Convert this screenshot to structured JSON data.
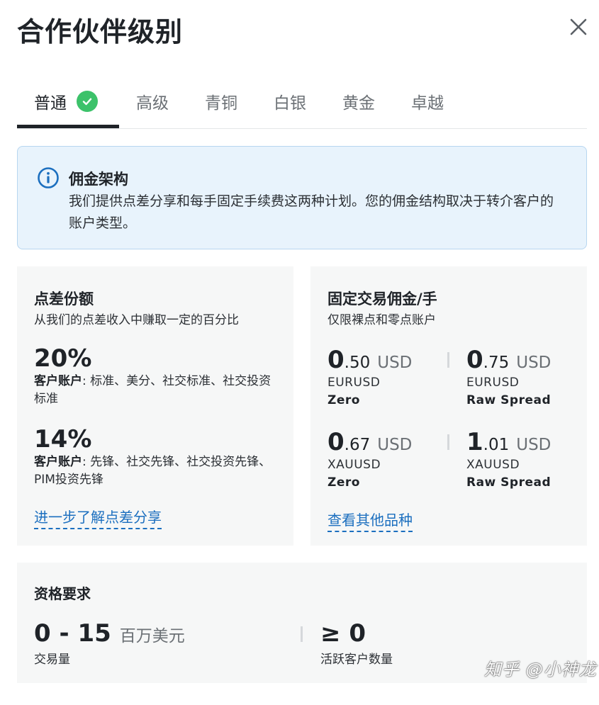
{
  "header": {
    "title": "合作伙伴级别"
  },
  "tabs": [
    {
      "label": "普通"
    },
    {
      "label": "高级"
    },
    {
      "label": "青铜"
    },
    {
      "label": "白银"
    },
    {
      "label": "黄金"
    },
    {
      "label": "卓越"
    }
  ],
  "info": {
    "title": "佣金架构",
    "text": "我们提供点差分享和每手固定手续费这两种计划。您的佣金结构取决于转介客户的账户类型。"
  },
  "spread": {
    "title": "点差份额",
    "subtitle": "从我们的点差收入中赚取一定的百分比",
    "tiers": [
      {
        "percent": "20%",
        "label": "客户账户",
        "accounts": ": 标准、美分、社交标准、社交投资标准"
      },
      {
        "percent": "14%",
        "label": "客户账户",
        "accounts": ": 先锋、社交先锋、社交投资先锋、PIM投资先锋"
      }
    ],
    "link": "进一步了解点差分享"
  },
  "fixed": {
    "title": "固定交易佣金/手",
    "subtitle": "仅限裸点和零点账户",
    "items": [
      {
        "int": "0",
        "dec": ".50",
        "unit": "USD",
        "symbol": "EURUSD",
        "type": "Zero"
      },
      {
        "int": "0",
        "dec": ".75",
        "unit": "USD",
        "symbol": "EURUSD",
        "type": "Raw Spread"
      },
      {
        "int": "0",
        "dec": ".67",
        "unit": "USD",
        "symbol": "XAUUSD",
        "type": "Zero"
      },
      {
        "int": "1",
        "dec": ".01",
        "unit": "USD",
        "symbol": "XAUUSD",
        "type": "Raw Spread"
      }
    ],
    "link": "查看其他品种"
  },
  "requirements": {
    "title": "资格要求",
    "volume": {
      "value": "0 - 15",
      "unit": "百万美元",
      "label": "交易量"
    },
    "clients": {
      "value": "≥ 0",
      "label": "活跃客户数量"
    }
  },
  "watermark": "知乎 @小神龙",
  "colors": {
    "accent": "#1c6fbf",
    "success": "#3cc26a",
    "info_bg": "#e8f3fc",
    "card_bg": "#f6f7f7"
  }
}
